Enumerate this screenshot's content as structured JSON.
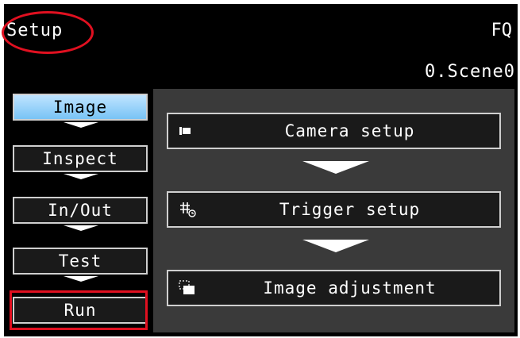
{
  "header": {
    "title": "Setup",
    "model": "FQ",
    "scene": "0.Scene0"
  },
  "flow": [
    {
      "label": "Image",
      "active": true
    },
    {
      "label": "Inspect",
      "active": false
    },
    {
      "label": "In/Out",
      "active": false
    },
    {
      "label": "Test",
      "active": false
    },
    {
      "label": "Run",
      "active": false
    }
  ],
  "menu": [
    {
      "label": "Camera setup",
      "icon": "camera-icon"
    },
    {
      "label": "Trigger setup",
      "icon": "trigger-icon"
    },
    {
      "label": "Image adjustment",
      "icon": "image-adjust-icon"
    }
  ],
  "colors": {
    "highlight": "#e01020",
    "active_step": "#78c3f5",
    "panel": "#3a3a3a"
  }
}
